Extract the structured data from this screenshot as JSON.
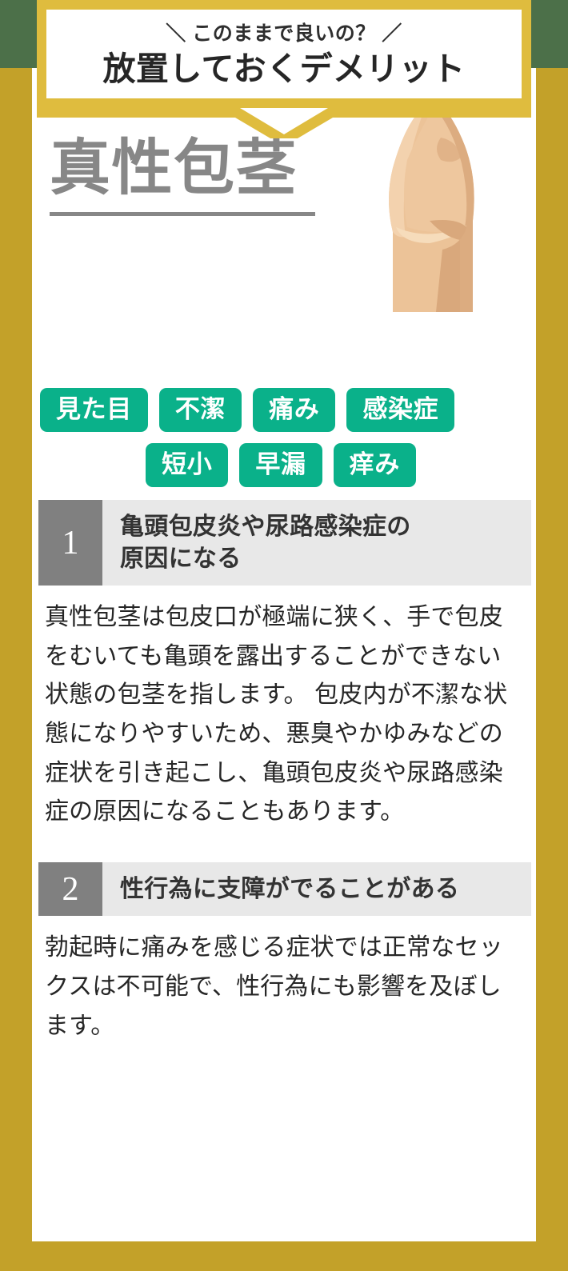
{
  "theme": {
    "green_band": "#4c7049",
    "gold_frame": "#c3a129",
    "gold_bubble": "#dfbc3e",
    "tag_green": "#0ab18a",
    "number_gray": "#808080",
    "headband_gray": "#e8e8e8",
    "title_gray": "#878787",
    "body_text": "#262626"
  },
  "header": {
    "kicker": "＼ このままで良いの？ ／",
    "title": "放置しておくデメリット"
  },
  "hero": {
    "title": "真性包茎",
    "illustration_name": "phimosis-anatomical-illustration"
  },
  "tags": {
    "row1": [
      "見た目",
      "不潔",
      "痛み",
      "感染症"
    ],
    "row2": [
      "短小",
      "早漏",
      "痒み"
    ]
  },
  "sections": [
    {
      "number": "1",
      "title": "亀頭包皮炎や尿路感染症の\n原因になる",
      "body": "真性包茎は包皮口が極端に狭く、手で包皮をむいても亀頭を露出することができない状態の包茎を指します。 包皮内が不潔な状態になりやすいため、悪臭やかゆみなどの症状を引き起こし、亀頭包皮炎や尿路感染症の原因になることもあります。"
    },
    {
      "number": "2",
      "title": "性行為に支障がでることがある",
      "body": "勃起時に痛みを感じる症状では正常なセックスは不可能で、性行為にも影響を及ぼします。"
    }
  ]
}
